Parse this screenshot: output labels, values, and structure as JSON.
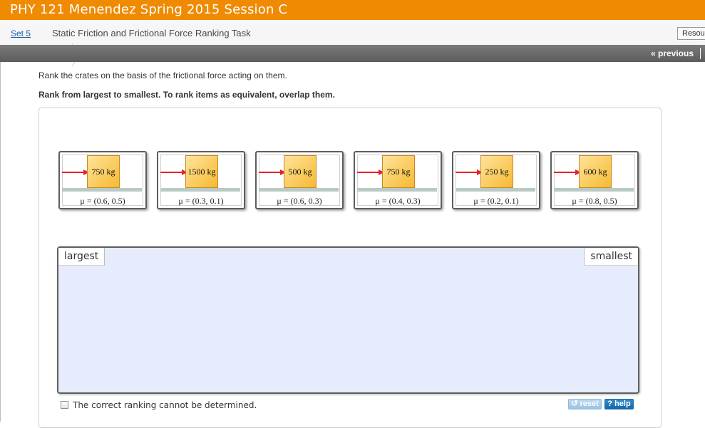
{
  "header": {
    "course_title": "PHY 121 Menendez Spring 2015 Session C"
  },
  "breadcrumb": {
    "set_link": "Set 5",
    "title": "Static Friction and Frictional Force Ranking Task",
    "resources_label": "Resources"
  },
  "nav": {
    "previous_label": "« previous"
  },
  "instructions": {
    "line1": "Rank the crates on the basis of the frictional force acting on them.",
    "line2": "Rank from largest to smallest. To rank items as equivalent, overlap them."
  },
  "crates": [
    {
      "mass": "750 kg",
      "mu": "μ = (0.6, 0.5)"
    },
    {
      "mass": "1500 kg",
      "mu": "μ = (0.3, 0.1)"
    },
    {
      "mass": "500 kg",
      "mu": "μ = (0.6, 0.3)"
    },
    {
      "mass": "750 kg",
      "mu": "μ = (0.4, 0.3)"
    },
    {
      "mass": "250 kg",
      "mu": "μ = (0.2, 0.1)"
    },
    {
      "mass": "600 kg",
      "mu": "μ = (0.8, 0.5)"
    }
  ],
  "ranking": {
    "left_label": "largest",
    "right_label": "smallest"
  },
  "footer": {
    "cannot_determine_label": "The correct ranking cannot be determined.",
    "cannot_determine_checked": false,
    "reset_label": "reset",
    "help_label": "help"
  },
  "icons": {
    "reset": "reset-icon",
    "help": "question-mark-icon",
    "force": "force-arrow-icon",
    "breadcrumb_separator": "chevron-right-icon"
  },
  "colors": {
    "header_orange": "#f08a00",
    "arrow_red": "#e8202a",
    "crate_gold": "#f6b932",
    "dropzone_blue": "#e6ecfc"
  }
}
